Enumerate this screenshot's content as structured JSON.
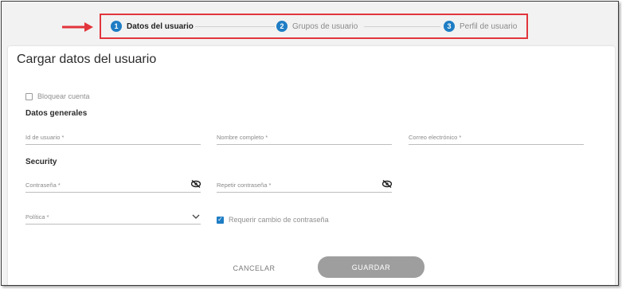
{
  "stepper": {
    "steps": [
      {
        "number": "1",
        "label": "Datos del usuario",
        "active": true
      },
      {
        "number": "2",
        "label": "Grupos de usuario",
        "active": false
      },
      {
        "number": "3",
        "label": "Perfil de usuario",
        "active": false
      }
    ]
  },
  "colors": {
    "highlight_border": "#e2353c",
    "accent": "#1f7dc4",
    "save_button": "#9e9e9e"
  },
  "form": {
    "title": "Cargar datos del usuario",
    "block_account_label": "Bloquear cuenta",
    "block_account_checked": false,
    "general_section": "Datos generales",
    "user_id_label": "Id de usuario *",
    "full_name_label": "Nombre completo *",
    "email_label": "Correo electrónico *",
    "security_section": "Security",
    "password_label": "Contraseña *",
    "repeat_password_label": "Repetir contraseña *",
    "policy_label": "Política *",
    "require_change_label": "Requerir cambio de contraseña",
    "require_change_checked": true
  },
  "actions": {
    "cancel_label": "CANCELAR",
    "save_label": "GUARDAR"
  },
  "icons": {
    "password_toggle": "eye-off-icon",
    "dropdown": "chevron-down-icon",
    "callout": "red-arrow-icon"
  }
}
